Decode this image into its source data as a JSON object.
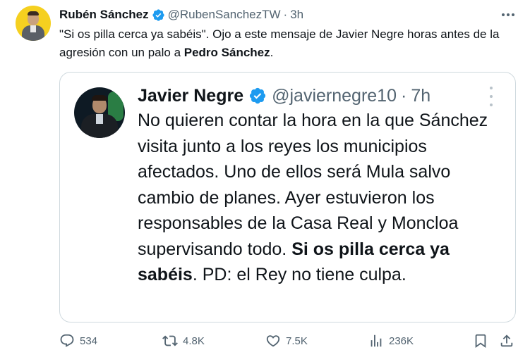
{
  "tweet": {
    "author": {
      "display_name": "Rubén Sánchez",
      "handle": "@RubenSanchezTW",
      "time": "3h",
      "verified": true,
      "avatar_icon": "user-avatar-photo"
    },
    "text_before": "\"Si os pilla cerca ya sabéis\". Ojo a este mensaje de Javier Negre horas antes de la agresión con un palo a ",
    "text_bold": "Pedro Sánchez",
    "text_after": ".",
    "more_icon": "more-horizontal-icon"
  },
  "quote": {
    "author": {
      "display_name": "Javier Negre",
      "handle": "@javiernegre10",
      "time": "7h",
      "verified": true,
      "avatar_icon": "user-avatar-photo"
    },
    "text_before": "No quieren contar la hora en la que Sánchez visita junto a los reyes los municipios afectados. Uno de ellos será Mula salvo cambio de planes. Ayer estuvieron los responsables de la Casa Real y Moncloa supervisando todo. ",
    "text_bold": "Si os pilla cerca ya sabéis",
    "text_after": ". PD: el Rey no tiene culpa.",
    "more_icon": "more-vertical-icon"
  },
  "actions": {
    "reply_count": "534",
    "retweet_count": "4.8K",
    "like_count": "7.5K",
    "views_count": "236K"
  },
  "colors": {
    "text": "#0f1419",
    "secondary": "#536471",
    "verified": "#1d9bf0",
    "border": "#cfd9de"
  }
}
